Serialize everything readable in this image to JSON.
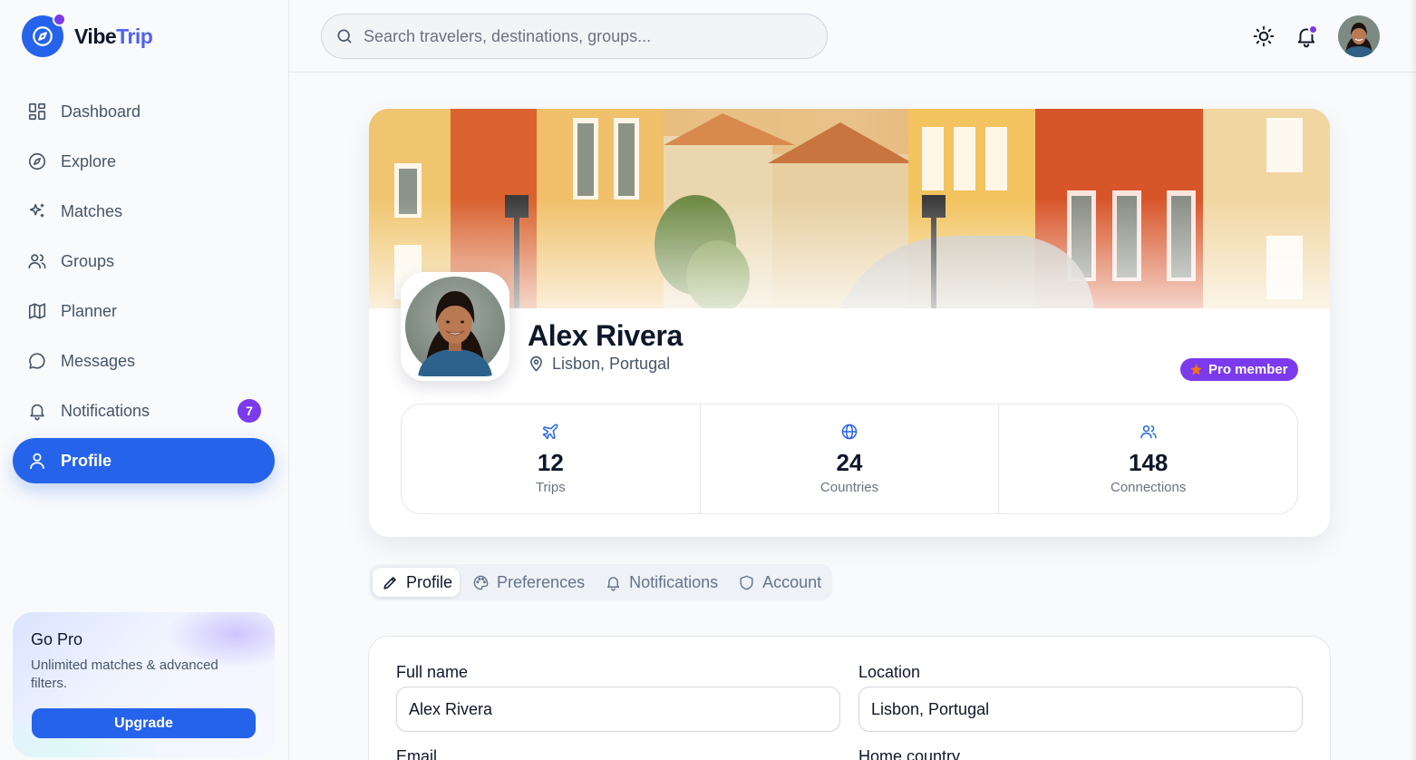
{
  "app": {
    "brand_part1": "Vibe",
    "brand_part2": "Trip",
    "colors": {
      "primary": "#2563eb",
      "accent": "#7c3aed",
      "orange": "#f97316"
    }
  },
  "sidebar": {
    "items": [
      {
        "label": "Dashboard",
        "icon": "grid-icon"
      },
      {
        "label": "Explore",
        "icon": "compass-icon"
      },
      {
        "label": "Matches",
        "icon": "sparkles-icon"
      },
      {
        "label": "Groups",
        "icon": "users-icon"
      },
      {
        "label": "Planner",
        "icon": "map-icon"
      },
      {
        "label": "Messages",
        "icon": "chat-bubble-icon"
      },
      {
        "label": "Notifications",
        "icon": "bell-icon",
        "badge": "7"
      },
      {
        "label": "Profile",
        "icon": "user-icon",
        "active": true
      }
    ],
    "gopro": {
      "title": "Go Pro",
      "text": "Unlimited matches & advanced filters.",
      "button": "Upgrade"
    }
  },
  "topbar": {
    "search_placeholder": "Search travelers, destinations, groups...",
    "icons": [
      "search-icon",
      "sun-icon",
      "bell-icon",
      "avatar"
    ]
  },
  "profile": {
    "name": "Alex Rivera",
    "location": "Lisbon, Portugal",
    "badge": "Pro member",
    "stats": [
      {
        "value": "12",
        "label": "Trips",
        "icon": "plane-icon"
      },
      {
        "value": "24",
        "label": "Countries",
        "icon": "globe-icon"
      },
      {
        "value": "148",
        "label": "Connections",
        "icon": "users-icon"
      }
    ]
  },
  "tabs": [
    {
      "label": "Profile",
      "icon": "pencil-icon",
      "active": true
    },
    {
      "label": "Preferences",
      "icon": "palette-icon"
    },
    {
      "label": "Notifications",
      "icon": "bell-icon"
    },
    {
      "label": "Account",
      "icon": "shield-icon"
    }
  ],
  "form": {
    "full_name_label": "Full name",
    "full_name_value": "Alex Rivera",
    "location_label": "Location",
    "location_value": "Lisbon, Portugal",
    "email_label": "Email",
    "home_country_label": "Home country"
  }
}
